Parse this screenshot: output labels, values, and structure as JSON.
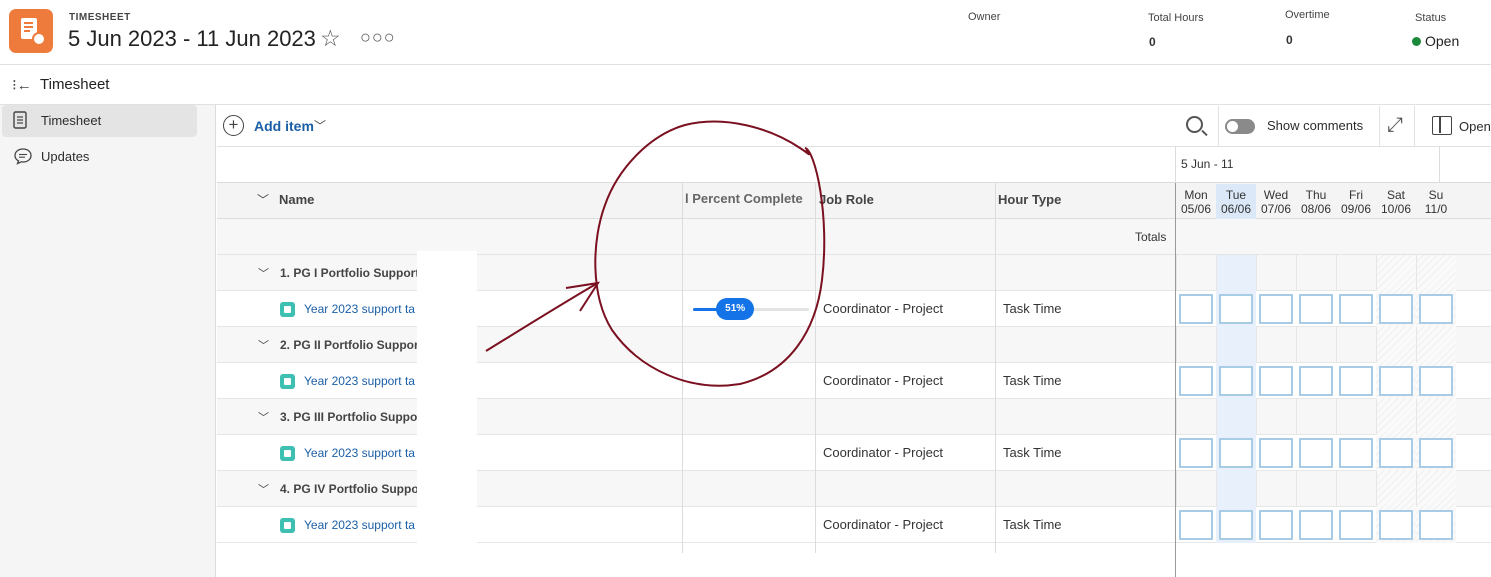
{
  "header": {
    "kicker": "TIMESHEET",
    "title": "5 Jun 2023 - 11 Jun 2023",
    "owner_label": "Owner",
    "total_hours_label": "Total Hours",
    "total_hours_value": "0",
    "overtime_label": "Overtime",
    "overtime_value": "0",
    "status_label": "Status",
    "status_value": "Open",
    "status_color": "#1a8a3a",
    "icons": {
      "app": "timesheet-icon",
      "favorite": "star-icon",
      "more": "more-icon"
    }
  },
  "subheader": {
    "title": "Timesheet",
    "icon": "collapse-panel-icon"
  },
  "nav": {
    "items": [
      {
        "label": "Timesheet",
        "icon": "document-icon",
        "active": true
      },
      {
        "label": "Updates",
        "icon": "comment-icon",
        "active": false
      }
    ]
  },
  "toolbar": {
    "add_item_label": "Add item",
    "show_comments_label": "Show comments",
    "show_comments_on": false,
    "open_label": "Open"
  },
  "grid": {
    "week_label": "5 Jun - 11",
    "columns": {
      "name": "Name",
      "percent_complete": "l Percent Complete",
      "job_role": "Job Role",
      "hour_type": "Hour Type"
    },
    "days": [
      {
        "name": "Mon",
        "date": "05/06"
      },
      {
        "name": "Tue",
        "date": "06/06"
      },
      {
        "name": "Wed",
        "date": "07/06"
      },
      {
        "name": "Thu",
        "date": "08/06"
      },
      {
        "name": "Fri",
        "date": "09/06"
      },
      {
        "name": "Sat",
        "date": "10/06"
      },
      {
        "name": "Su",
        "date": "11/0"
      }
    ],
    "today_index": 1,
    "totals_label": "Totals",
    "groups": [
      {
        "name": "1. PG I Portfolio Support",
        "task": "Year 2023 support ta",
        "percent_complete": 51,
        "percent_label": "51%",
        "job_role": "Coordinator - Project",
        "hour_type": "Task Time"
      },
      {
        "name": "2. PG II Portfolio Suppor",
        "task": "Year 2023 support ta",
        "percent_complete": null,
        "percent_label": "",
        "job_role": "Coordinator - Project",
        "hour_type": "Task Time"
      },
      {
        "name": "3. PG III Portfolio Suppo",
        "task": "Year 2023 support ta",
        "percent_complete": null,
        "percent_label": "",
        "job_role": "Coordinator - Project",
        "hour_type": "Task Time"
      },
      {
        "name": "4. PG IV Portfolio Suppo",
        "task": "Year 2023 support ta",
        "percent_complete": null,
        "percent_label": "",
        "job_role": "Coordinator - Project",
        "hour_type": "Task Time"
      }
    ]
  },
  "annotation": {
    "color": "#7a1020"
  }
}
